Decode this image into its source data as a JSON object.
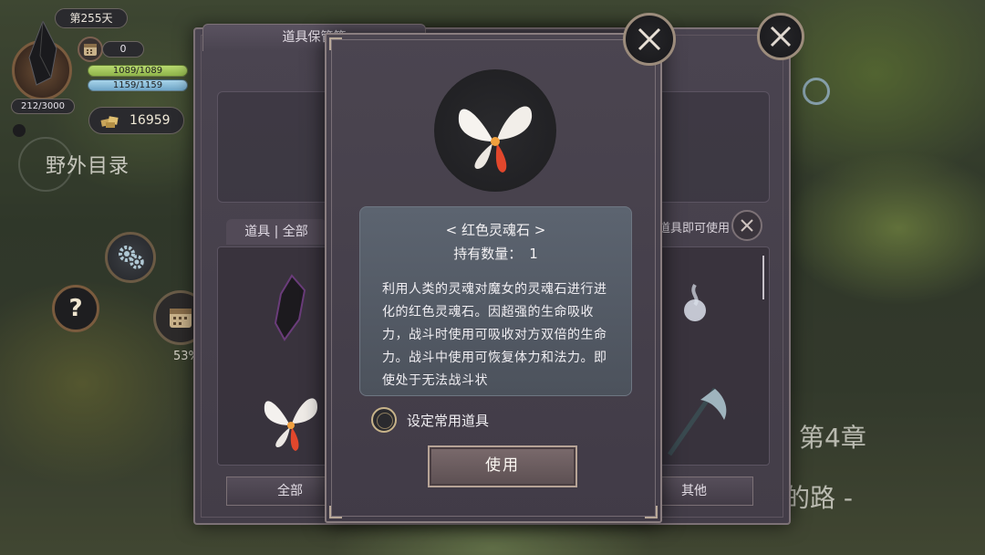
{
  "hud": {
    "day": "第255天",
    "xp": "212/3000",
    "counter": "0",
    "hp": "1089/1089",
    "mp": "1159/1159",
    "gold": "16959",
    "field_title": "野外目录",
    "help": "?",
    "progress_pct": "53%"
  },
  "background": {
    "chapter": "第4章",
    "road_fragment": "巢的路 -"
  },
  "inventory": {
    "title": "道具保管箱",
    "filter_label": "道具 | 全部",
    "right_label": "道具即可使用",
    "tabs": [
      "全部",
      "其他"
    ]
  },
  "item_modal": {
    "name": "< 红色灵魂石 >",
    "quantity_label": "持有数量：",
    "quantity": "1",
    "description": "利用人类的灵魂对魔女的灵魂石进行进化的红色灵魂石。因超强的生命吸收力，战斗时使用可吸收对方双倍的生命力。战斗中使用可恢复体力和法力。即使处于无法战斗状",
    "favorite_label": "设定常用道具",
    "favorite_checked": false,
    "use_button": "使用"
  },
  "icons": {
    "item": "butterfly-soulstone-icon",
    "close": "close-icon",
    "gold": "gold-icon",
    "calendar": "calendar-icon",
    "gear": "gear-icon"
  },
  "colors": {
    "accent": "#b6a396",
    "hp_bar": "#a3c65a",
    "mp_bar": "#8cbcd8",
    "panel": "#474150"
  }
}
